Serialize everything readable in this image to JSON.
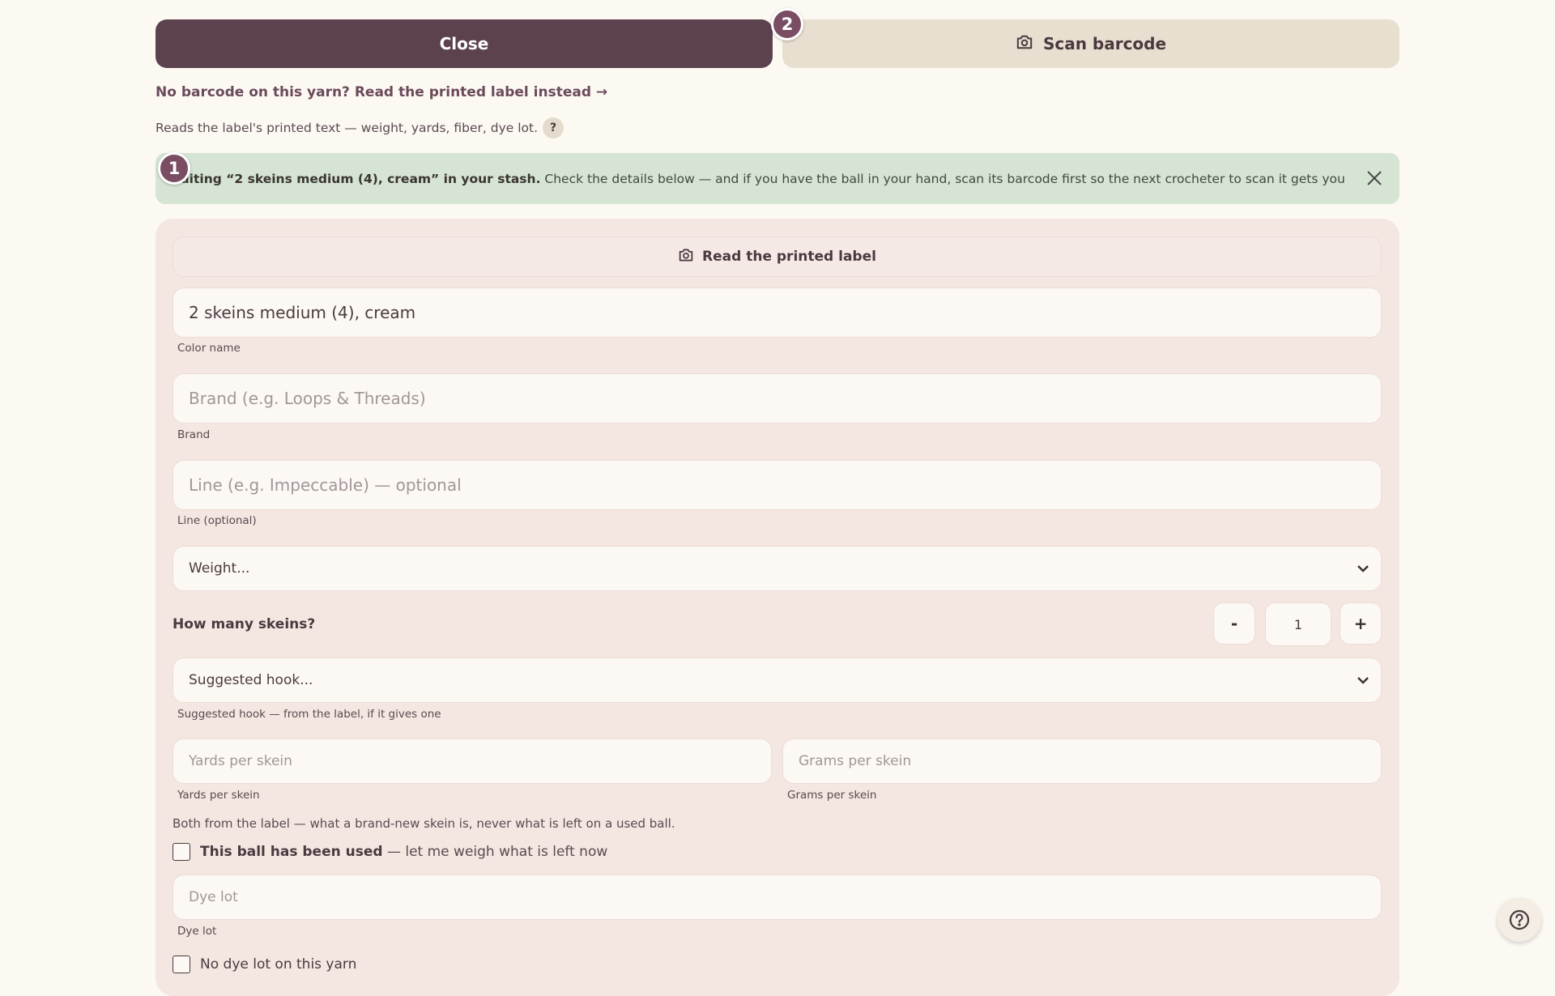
{
  "top": {
    "close_label": "Close",
    "scan_label": "Scan barcode",
    "badge_step2": "2",
    "label_link": "No barcode on this yarn? Read the printed label instead →",
    "label_hint": "Reads the label's printed text — weight, yards, fiber, dye lot.",
    "help_q": "?"
  },
  "banner": {
    "badge_step1": "1",
    "bold_text": "Editing “2 skeins medium (4), cream” in your stash.",
    "body_text": "Check the details below — and if you have the ball in your hand, scan its barcode first so the next crocheter to scan it gets your yarn details.",
    "bg_color": "#d5e4d3"
  },
  "form": {
    "read_label_button": "Read the printed label",
    "color_name": {
      "value": "2 skeins medium (4), cream",
      "caption": "Color name"
    },
    "brand": {
      "value": "",
      "placeholder": "Brand (e.g. Loops & Threads)",
      "caption": "Brand"
    },
    "line": {
      "value": "",
      "placeholder": "Line (e.g. Impeccable) — optional",
      "caption": "Line (optional)"
    },
    "weight": {
      "selected": "Weight..."
    },
    "skeins": {
      "label": "How many skeins?",
      "minus": "-",
      "value": "1",
      "plus": "+"
    },
    "hook": {
      "selected": "Suggested hook...",
      "caption": "Suggested hook — from the label, if it gives one"
    },
    "yards": {
      "value": "",
      "placeholder": "Yards per skein",
      "caption": "Yards per skein"
    },
    "grams": {
      "value": "",
      "placeholder": "Grams per skein",
      "caption": "Grams per skein"
    },
    "note": "Both from the label — what a brand-new skein is, never what is left on a used ball.",
    "used_check": {
      "checked": false,
      "bold": "This ball has been used",
      "tail": " — let me weigh what is left now"
    },
    "dye_lot": {
      "value": "",
      "placeholder": "Dye lot",
      "caption": "Dye lot"
    },
    "no_dye_lot_check": {
      "checked": false,
      "label": "No dye lot on this yarn"
    }
  },
  "colors": {
    "primary": "#5c424f",
    "secondary": "#e7dfd0",
    "panel": "#f4e6e1",
    "badge": "#7a4d62"
  },
  "icons": {
    "scan": "camera-icon",
    "read_label": "camera-icon",
    "dismiss": "close-icon",
    "select": "chevron-down-icon",
    "help": "help-circle-icon"
  }
}
